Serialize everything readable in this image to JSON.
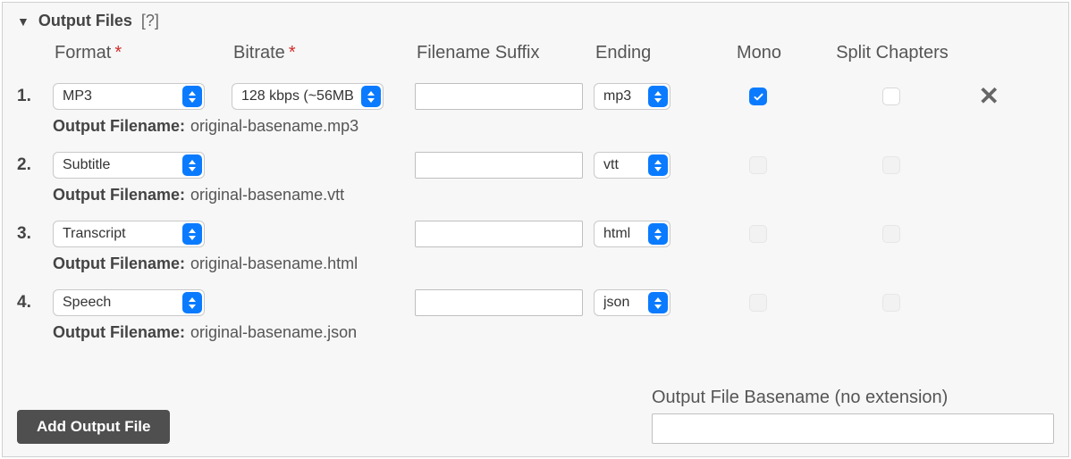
{
  "header": {
    "title": "Output Files",
    "help": "[?]"
  },
  "columns": {
    "format": "Format",
    "bitrate": "Bitrate",
    "suffix": "Filename Suffix",
    "ending": "Ending",
    "mono": "Mono",
    "split": "Split Chapters"
  },
  "required_mark": "*",
  "output_filename_label": "Output Filename:",
  "rows": [
    {
      "num": "1.",
      "format": "MP3",
      "bitrate": "128 kbps (~56MB",
      "suffix": "",
      "ending": "mp3",
      "mono_checked": true,
      "mono_enabled": true,
      "split_checked": false,
      "split_enabled": true,
      "removable": true,
      "output_filename": "original-basename.mp3"
    },
    {
      "num": "2.",
      "format": "Subtitle",
      "bitrate": "",
      "suffix": "",
      "ending": "vtt",
      "mono_checked": false,
      "mono_enabled": false,
      "split_checked": false,
      "split_enabled": false,
      "removable": false,
      "output_filename": "original-basename.vtt"
    },
    {
      "num": "3.",
      "format": "Transcript",
      "bitrate": "",
      "suffix": "",
      "ending": "html",
      "mono_checked": false,
      "mono_enabled": false,
      "split_checked": false,
      "split_enabled": false,
      "removable": false,
      "output_filename": "original-basename.html"
    },
    {
      "num": "4.",
      "format": "Speech",
      "bitrate": "",
      "suffix": "",
      "ending": "json",
      "mono_checked": false,
      "mono_enabled": false,
      "split_checked": false,
      "split_enabled": false,
      "removable": false,
      "output_filename": "original-basename.json"
    }
  ],
  "footer": {
    "add_button": "Add Output File",
    "basename_label": "Output File Basename (no extension)",
    "basename_value": ""
  }
}
